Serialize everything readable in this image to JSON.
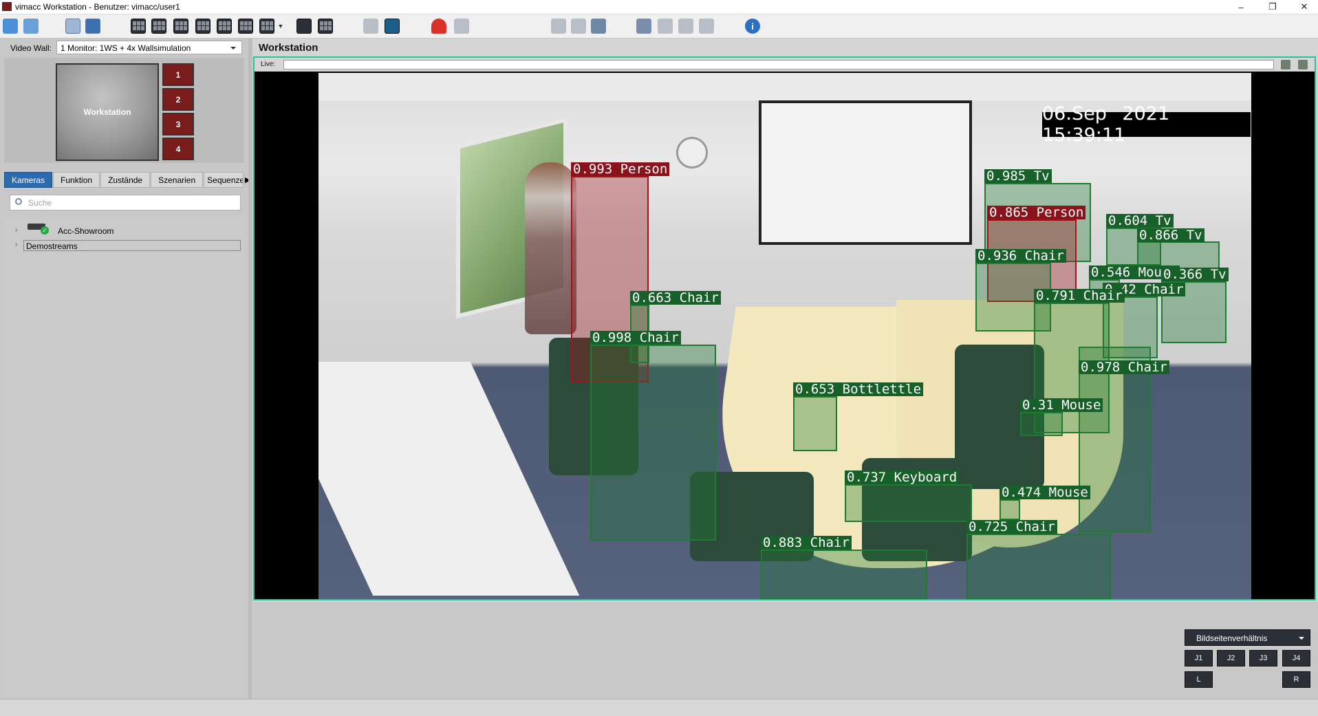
{
  "window": {
    "title": "vimacc Workstation - Benutzer: vimacc/user1",
    "controls": {
      "minimize": "–",
      "maximize": "❐",
      "close": "✕"
    }
  },
  "toolbar": {
    "icons": [
      "camera-group-icon",
      "camera-add-icon",
      "network-icon",
      "user-icon",
      "layout-1x1-icon",
      "layout-2x2-icon",
      "layout-2x3-icon",
      "layout-3x3-icon",
      "layout-3x4-icon",
      "layout-4x4-icon",
      "layout-custom-icon",
      "monitor-icon",
      "grid-icon",
      "snapshot-icon",
      "fullscreen-icon",
      "alarm-icon",
      "user-remove-icon",
      "search-icon",
      "display-icon",
      "print-icon",
      "settings-icon",
      "export-icon",
      "import-icon",
      "tools-icon",
      "info-icon"
    ],
    "info_glyph": "i"
  },
  "left": {
    "video_wall_label": "Video Wall:",
    "video_wall_value": "1 Monitor: 1WS + 4x Wallsimulation",
    "workstation_label": "Workstation",
    "monitors": [
      "1",
      "2",
      "3",
      "4"
    ],
    "tabs": [
      "Kameras",
      "Funktion",
      "Zustände",
      "Szenarien",
      "Sequenze"
    ],
    "search_placeholder": "Suche",
    "tree": [
      "Acc-Showroom",
      "Demostreams"
    ]
  },
  "main": {
    "title": "Workstation",
    "live_label": "Live:",
    "timestamp": "06.Sep 2021 15:39:11",
    "detections": [
      {
        "label": "0.993 Person",
        "color": "red"
      },
      {
        "label": "0.985 Tv",
        "color": "green"
      },
      {
        "label": "0.865 Person",
        "color": "red"
      },
      {
        "label": "0.604 Tv",
        "color": "green"
      },
      {
        "label": "0.866 Tv",
        "color": "green"
      },
      {
        "label": "0.936 Chair",
        "color": "green"
      },
      {
        "label": "0.546 Mouse",
        "color": "green"
      },
      {
        "label": "0.366 Tv",
        "color": "green"
      },
      {
        "label": "0.42 Chair",
        "color": "green"
      },
      {
        "label": "0.663 Chair",
        "color": "green"
      },
      {
        "label": "0.791 Chair",
        "color": "green"
      },
      {
        "label": "0.998 Chair",
        "color": "green"
      },
      {
        "label": "0.978 Chair",
        "color": "green"
      },
      {
        "label": "0.653 Bottlettle",
        "color": "green"
      },
      {
        "label": "0.31 Mouse",
        "color": "green"
      },
      {
        "label": "0.737 Keyboard",
        "color": "green"
      },
      {
        "label": "0.474 Mouse",
        "color": "green"
      },
      {
        "label": "0.725 Chair",
        "color": "green"
      },
      {
        "label": "0.883 Chair",
        "color": "green"
      }
    ]
  },
  "bottom": {
    "aspect_label": "Bildseitenverhältnis",
    "j_buttons": [
      "J1",
      "J2",
      "J3",
      "J4"
    ],
    "l_button": "L",
    "r_button": "R"
  },
  "colors": {
    "accent": "#29c29a",
    "monitor_red": "#7a1c1c",
    "tab_blue": "#2d6bb0",
    "detect_green": "#18602a",
    "detect_red": "#8a121b"
  }
}
